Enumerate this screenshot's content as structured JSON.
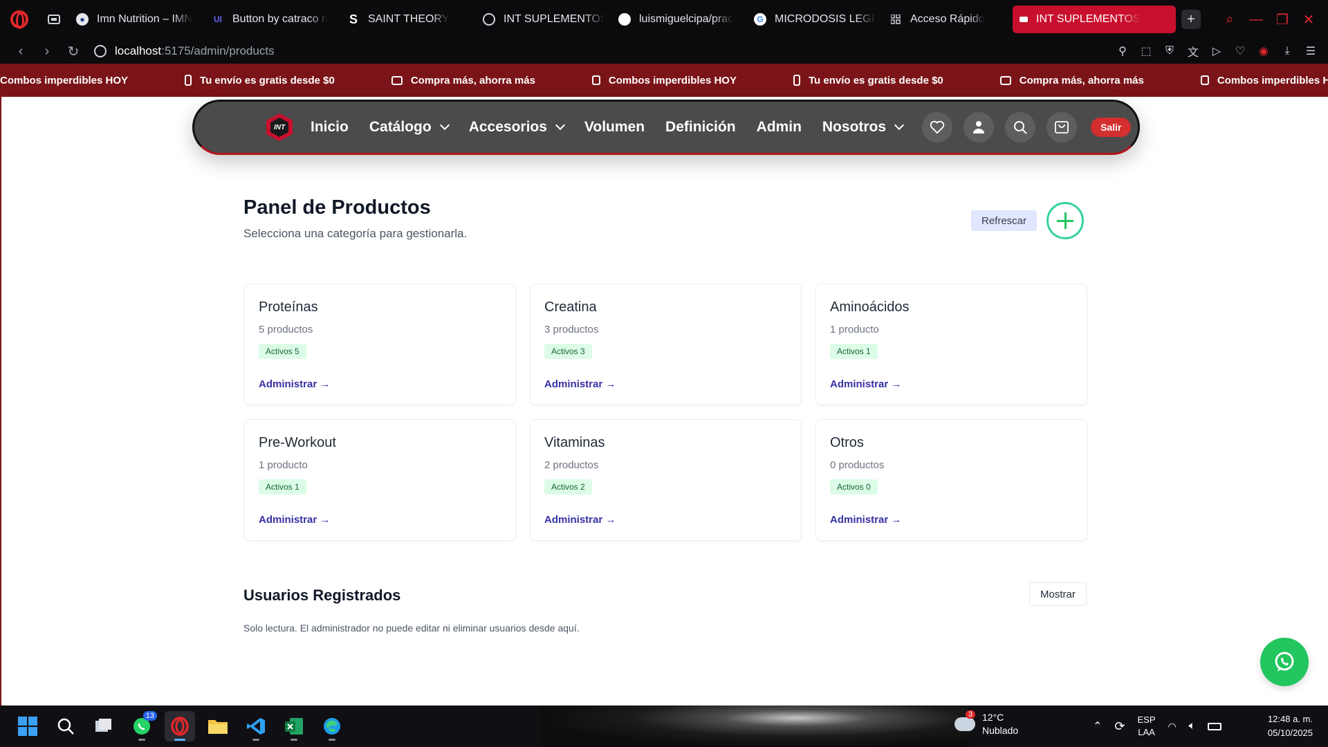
{
  "browser": {
    "tabs": [
      {
        "title": "Imn Nutrition – IMN",
        "icon": "imn-favicon"
      },
      {
        "title": "Button by catraco n",
        "icon": "uiverse-favicon"
      },
      {
        "title": "SAINT THEORY",
        "icon": "saint-favicon"
      },
      {
        "title": "INT SUPLEMENTOS",
        "icon": "globe-favicon"
      },
      {
        "title": "luismiguelcipa/prac",
        "icon": "github-favicon"
      },
      {
        "title": "MICRODOSIS LEGE",
        "icon": "google-favicon"
      },
      {
        "title": "Acceso Rápido",
        "icon": "grid-favicon"
      }
    ],
    "active_tab": "INT SUPLEMENTOS",
    "url_host": "localhost",
    "url_path": ":5175/admin/products",
    "accent": "#c8102e"
  },
  "marquee": {
    "items": [
      "Combos imperdibles HOY",
      "Tu envío es gratis desde $0",
      "Compra más, ahorra más",
      "Combos imperdibles HOY",
      "Tu envío es gratis desde $0",
      "Compra más, ahorra más",
      "Combos imperdibles HO"
    ]
  },
  "nav": {
    "brand": "INT",
    "links": [
      {
        "label": "Inicio",
        "dropdown": false
      },
      {
        "label": "Catálogo",
        "dropdown": true
      },
      {
        "label": "Accesorios",
        "dropdown": true
      },
      {
        "label": "Volumen",
        "dropdown": false
      },
      {
        "label": "Definición",
        "dropdown": false
      },
      {
        "label": "Admin",
        "dropdown": false
      },
      {
        "label": "Nosotros",
        "dropdown": true
      }
    ],
    "logout": "Salir"
  },
  "panel": {
    "title": "Panel de Productos",
    "subtitle": "Selecciona una categoría para gestionarla.",
    "refresh": "Refrescar",
    "categories": [
      {
        "name": "Proteínas",
        "count": "5 productos",
        "active": "Activos 5",
        "action": "Administrar →"
      },
      {
        "name": "Creatina",
        "count": "3 productos",
        "active": "Activos 3",
        "action": "Administrar →"
      },
      {
        "name": "Aminoácidos",
        "count": "1 producto",
        "active": "Activos 1",
        "action": "Administrar →"
      },
      {
        "name": "Pre-Workout",
        "count": "1 producto",
        "active": "Activos 1",
        "action": "Administrar →"
      },
      {
        "name": "Vitaminas",
        "count": "2 productos",
        "active": "Activos 2",
        "action": "Administrar →"
      },
      {
        "name": "Otros",
        "count": "0 productos",
        "active": "Activos 0",
        "action": "Administrar →"
      }
    ]
  },
  "users": {
    "title": "Usuarios Registrados",
    "toggle": "Mostrar",
    "note": "Solo lectura. El administrador no puede editar ni eliminar usuarios desde aquí."
  },
  "taskbar": {
    "whatsapp_badge": "13",
    "weather_badge": "3",
    "temperature": "12°C",
    "condition": "Nublado",
    "lang_top": "ESP",
    "lang_bottom": "LAA",
    "time": "12:48 a. m.",
    "date": "05/10/2025"
  }
}
